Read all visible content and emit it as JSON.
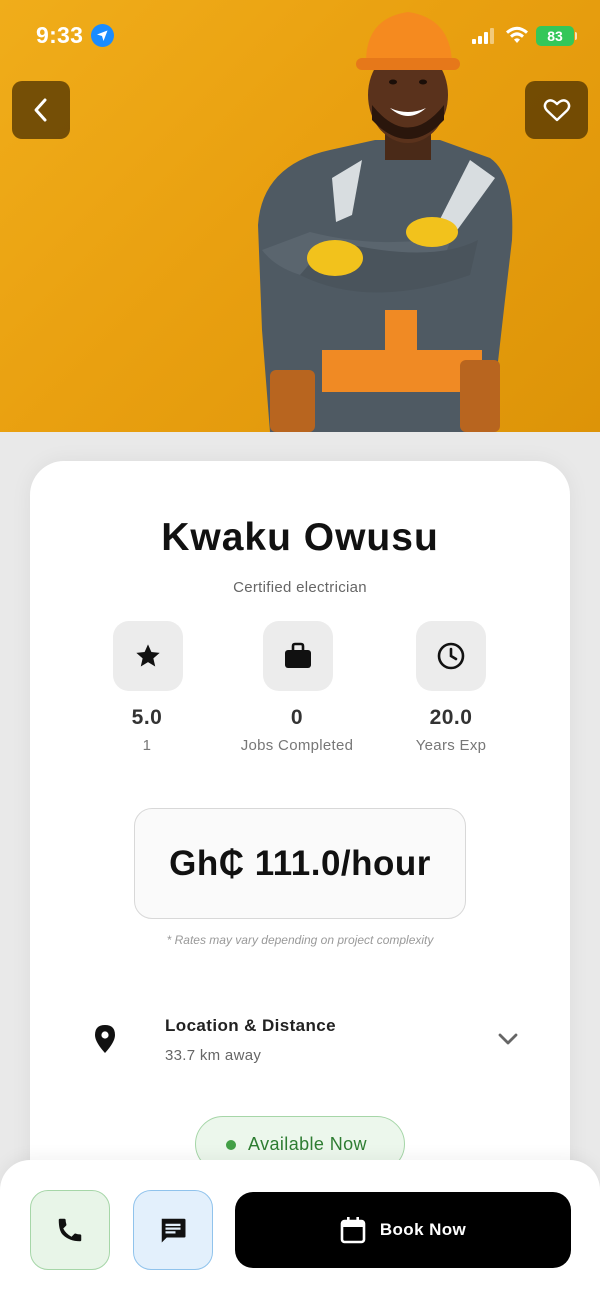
{
  "status_bar": {
    "time": "9:33",
    "battery": "83"
  },
  "hero": {
    "background_color": "#e9a010",
    "back_icon": "chevron-left-icon",
    "favorite_icon": "heart-icon"
  },
  "profile": {
    "name": "Kwaku Owusu",
    "title": "Certified electrician",
    "stats": [
      {
        "icon": "star-icon",
        "value": "5.0",
        "label": "1"
      },
      {
        "icon": "briefcase-icon",
        "value": "0",
        "label": "Jobs Completed"
      },
      {
        "icon": "clock-icon",
        "value": "20.0",
        "label": "Years Exp"
      }
    ],
    "rate": "Gh₵ 111.0/hour",
    "rate_note": "* Rates may vary depending on project complexity",
    "location": {
      "title": "Location & Distance",
      "distance": "33.7 km away"
    },
    "availability": "Available Now",
    "availability_color": "#2e7d32"
  },
  "actions": {
    "call_icon": "phone-icon",
    "message_icon": "message-icon",
    "book_label": "Book Now",
    "book_icon": "calendar-icon"
  }
}
